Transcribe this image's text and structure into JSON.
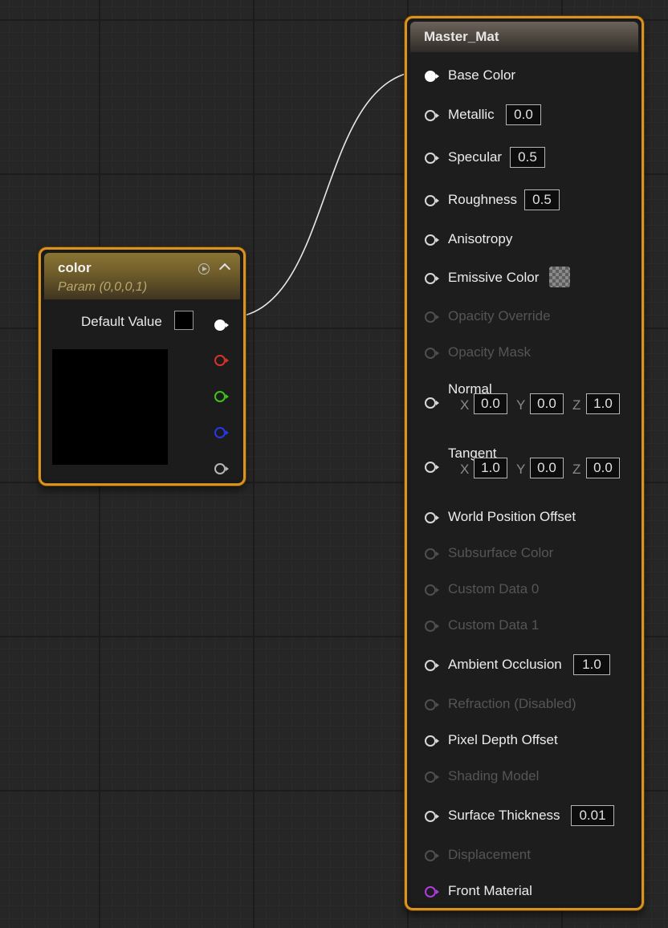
{
  "param_node": {
    "title": "color",
    "subtitle": "Param (0,0,0,1)",
    "default_value_label": "Default Value",
    "default_value_color": "#000000",
    "preview_color": "#000000",
    "output_pins": [
      {
        "name": "rgba",
        "color": "#ffffff",
        "connected": true
      },
      {
        "name": "r",
        "color": "#d8322a"
      },
      {
        "name": "g",
        "color": "#40c21a"
      },
      {
        "name": "b",
        "color": "#2638e8"
      },
      {
        "name": "a",
        "color": "#b5b5b5"
      }
    ]
  },
  "master_node": {
    "title": "Master_Mat",
    "pins": {
      "base_color": {
        "label": "Base Color",
        "connected": true
      },
      "metallic": {
        "label": "Metallic",
        "value": "0.0"
      },
      "specular": {
        "label": "Specular",
        "value": "0.5"
      },
      "roughness": {
        "label": "Roughness",
        "value": "0.5"
      },
      "anisotropy": {
        "label": "Anisotropy"
      },
      "emissive_color": {
        "label": "Emissive Color"
      },
      "opacity_override": {
        "label": "Opacity Override",
        "enabled": false
      },
      "opacity_mask": {
        "label": "Opacity Mask",
        "enabled": false
      },
      "normal": {
        "label": "Normal",
        "x_label": "X",
        "x": "0.0",
        "y_label": "Y",
        "y": "0.0",
        "z_label": "Z",
        "z": "1.0"
      },
      "tangent": {
        "label": "Tangent",
        "x_label": "X",
        "x": "1.0",
        "y_label": "Y",
        "y": "0.0",
        "z_label": "Z",
        "z": "0.0"
      },
      "world_position_offset": {
        "label": "World Position Offset"
      },
      "subsurface_color": {
        "label": "Subsurface Color",
        "enabled": false
      },
      "custom_data_0": {
        "label": "Custom Data 0",
        "enabled": false
      },
      "custom_data_1": {
        "label": "Custom Data 1",
        "enabled": false
      },
      "ambient_occlusion": {
        "label": "Ambient Occlusion",
        "value": "1.0"
      },
      "refraction": {
        "label": "Refraction (Disabled)",
        "enabled": false
      },
      "pixel_depth_offset": {
        "label": "Pixel Depth Offset"
      },
      "shading_model": {
        "label": "Shading Model",
        "enabled": false
      },
      "surface_thickness": {
        "label": "Surface Thickness",
        "value": "0.01"
      },
      "displacement": {
        "label": "Displacement",
        "enabled": false
      },
      "front_material": {
        "label": "Front Material",
        "pin_color": "#b03ce0"
      }
    }
  },
  "colors": {
    "node_border": "#d9931e",
    "wire": "#e8e8e8",
    "background": "#262626"
  }
}
